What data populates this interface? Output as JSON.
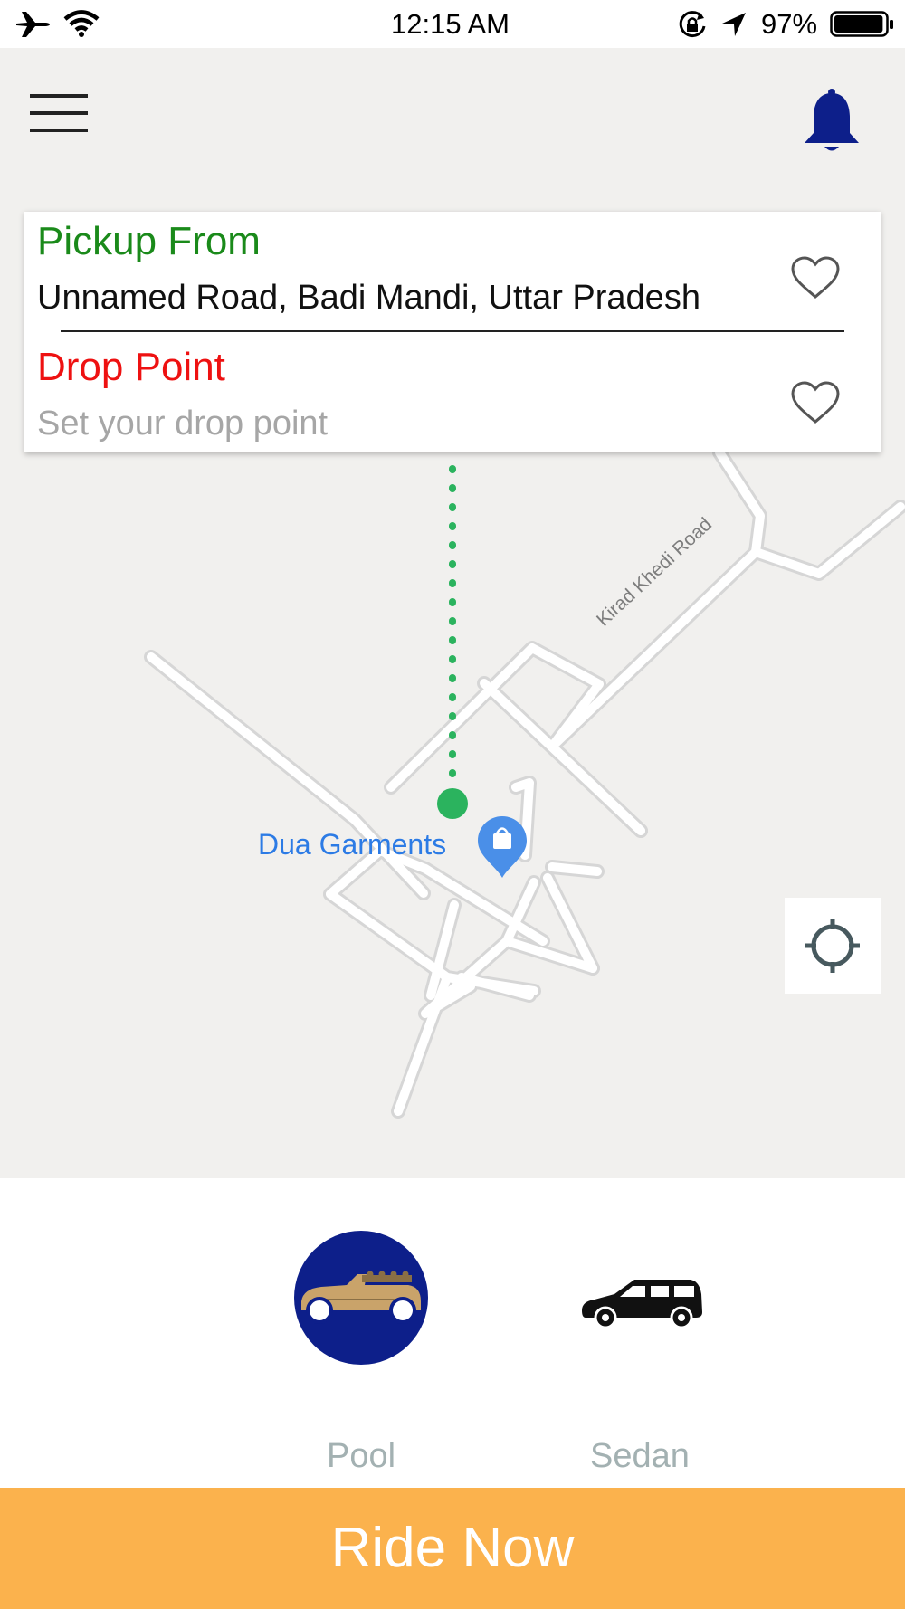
{
  "status_bar": {
    "time": "12:15 AM",
    "battery_percent": "97%",
    "battery_level": 0.97
  },
  "header": {
    "menu_icon": "hamburger-menu-icon",
    "notification_icon": "bell-icon"
  },
  "location_card": {
    "pickup": {
      "label": "Pickup From",
      "value": "Unnamed Road, Badi Mandi, Uttar Pradesh",
      "label_color": "#1a8a1a"
    },
    "drop": {
      "label": "Drop Point",
      "placeholder": "Set your drop point",
      "label_color": "#ee1111"
    }
  },
  "map": {
    "road_label": "Kirad Khedi Road",
    "poi_label": "Dua Garments",
    "pickup_marker_color": "#2bb35e",
    "poi_color": "#4a8fe8"
  },
  "vehicles": [
    {
      "label": "Pool",
      "selected": true,
      "icon": "convertible-car-icon"
    },
    {
      "label": "Sedan",
      "selected": false,
      "icon": "sedan-car-icon"
    }
  ],
  "colors": {
    "accent_blue": "#0d1f8a",
    "ride_button": "#fbb24d"
  },
  "ride_button": {
    "label": "Ride Now"
  }
}
